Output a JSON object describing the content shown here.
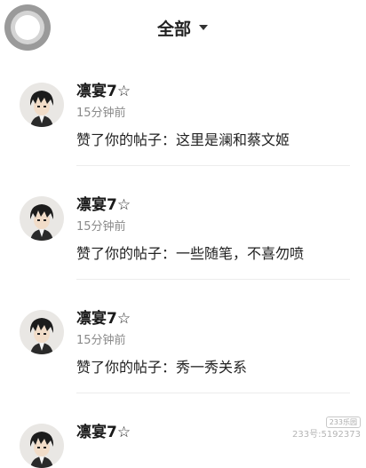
{
  "header": {
    "filter_label": "全部",
    "icons": {
      "home": "home-circle-icon",
      "dropdown": "caret-down-icon"
    }
  },
  "notifications": [
    {
      "username": "凛宴7☆",
      "time": "15分钟前",
      "message": "赞了你的帖子：这里是澜和蔡文姬"
    },
    {
      "username": "凛宴7☆",
      "time": "15分钟前",
      "message": "赞了你的帖子：一些随笔，不喜勿喷"
    },
    {
      "username": "凛宴7☆",
      "time": "15分钟前",
      "message": "赞了你的帖子：秀一秀关系"
    },
    {
      "username": "凛宴7☆"
    }
  ],
  "watermark": {
    "badge": "233乐园",
    "text": "233号:5192373"
  },
  "colors": {
    "background": "#ffffff",
    "text": "#222222",
    "secondary_text": "#8a8a8a",
    "divider": "#ececec"
  }
}
